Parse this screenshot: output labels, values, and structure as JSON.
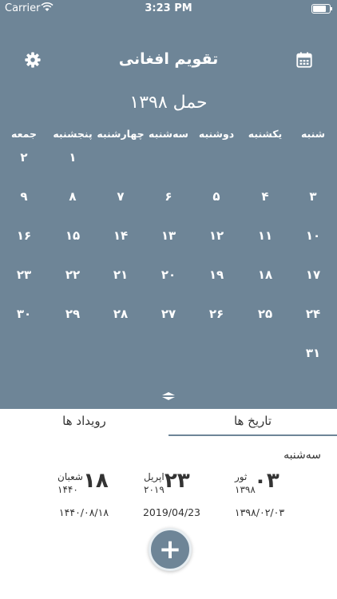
{
  "status": {
    "carrier": "Carrier",
    "time": "3:23 PM",
    "battery_level": 0.8
  },
  "header": {
    "title": "تقویم افغانی",
    "settings_icon": "gear-icon",
    "calendar_icon": "calendar-icon"
  },
  "calendar": {
    "month_title": "حمل ۱۳۹۸",
    "weekdays": [
      "شنبه",
      "یکشنبه",
      "دوشنبه",
      "سه‌شنبه",
      "چهارشنبه",
      "پنجشنبه",
      "جمعه"
    ],
    "weeks": [
      [
        "",
        "",
        "",
        "",
        "",
        "۱",
        "۲"
      ],
      [
        "۳",
        "۴",
        "۵",
        "۶",
        "۷",
        "۸",
        "۹"
      ],
      [
        "۱۰",
        "۱۱",
        "۱۲",
        "۱۳",
        "۱۴",
        "۱۵",
        "۱۶"
      ],
      [
        "۱۷",
        "۱۸",
        "۱۹",
        "۲۰",
        "۲۱",
        "۲۲",
        "۲۳"
      ],
      [
        "۲۴",
        "۲۵",
        "۲۶",
        "۲۷",
        "۲۸",
        "۲۹",
        "۳۰"
      ],
      [
        "۳۱",
        "",
        "",
        "",
        "",
        "",
        ""
      ]
    ]
  },
  "tabs": {
    "dates": "تاریخ ها",
    "events": "رویداد ها"
  },
  "today": {
    "weekday": "سه‌شنبه",
    "solar": {
      "day": "۰۳",
      "month": "ثور",
      "year": "۱۳۹۸",
      "full": "۱۳۹۸/۰۲/۰۳"
    },
    "gregorian": {
      "day": "۲۳",
      "month": "اپریل",
      "year": "۲۰۱۹",
      "full": "2019/04/23"
    },
    "lunar": {
      "day": "۱۸",
      "month": "شعبان",
      "year": "۱۴۴۰",
      "full": "۱۴۴۰/۰۸/۱۸"
    }
  },
  "fab": {
    "label": "+"
  }
}
